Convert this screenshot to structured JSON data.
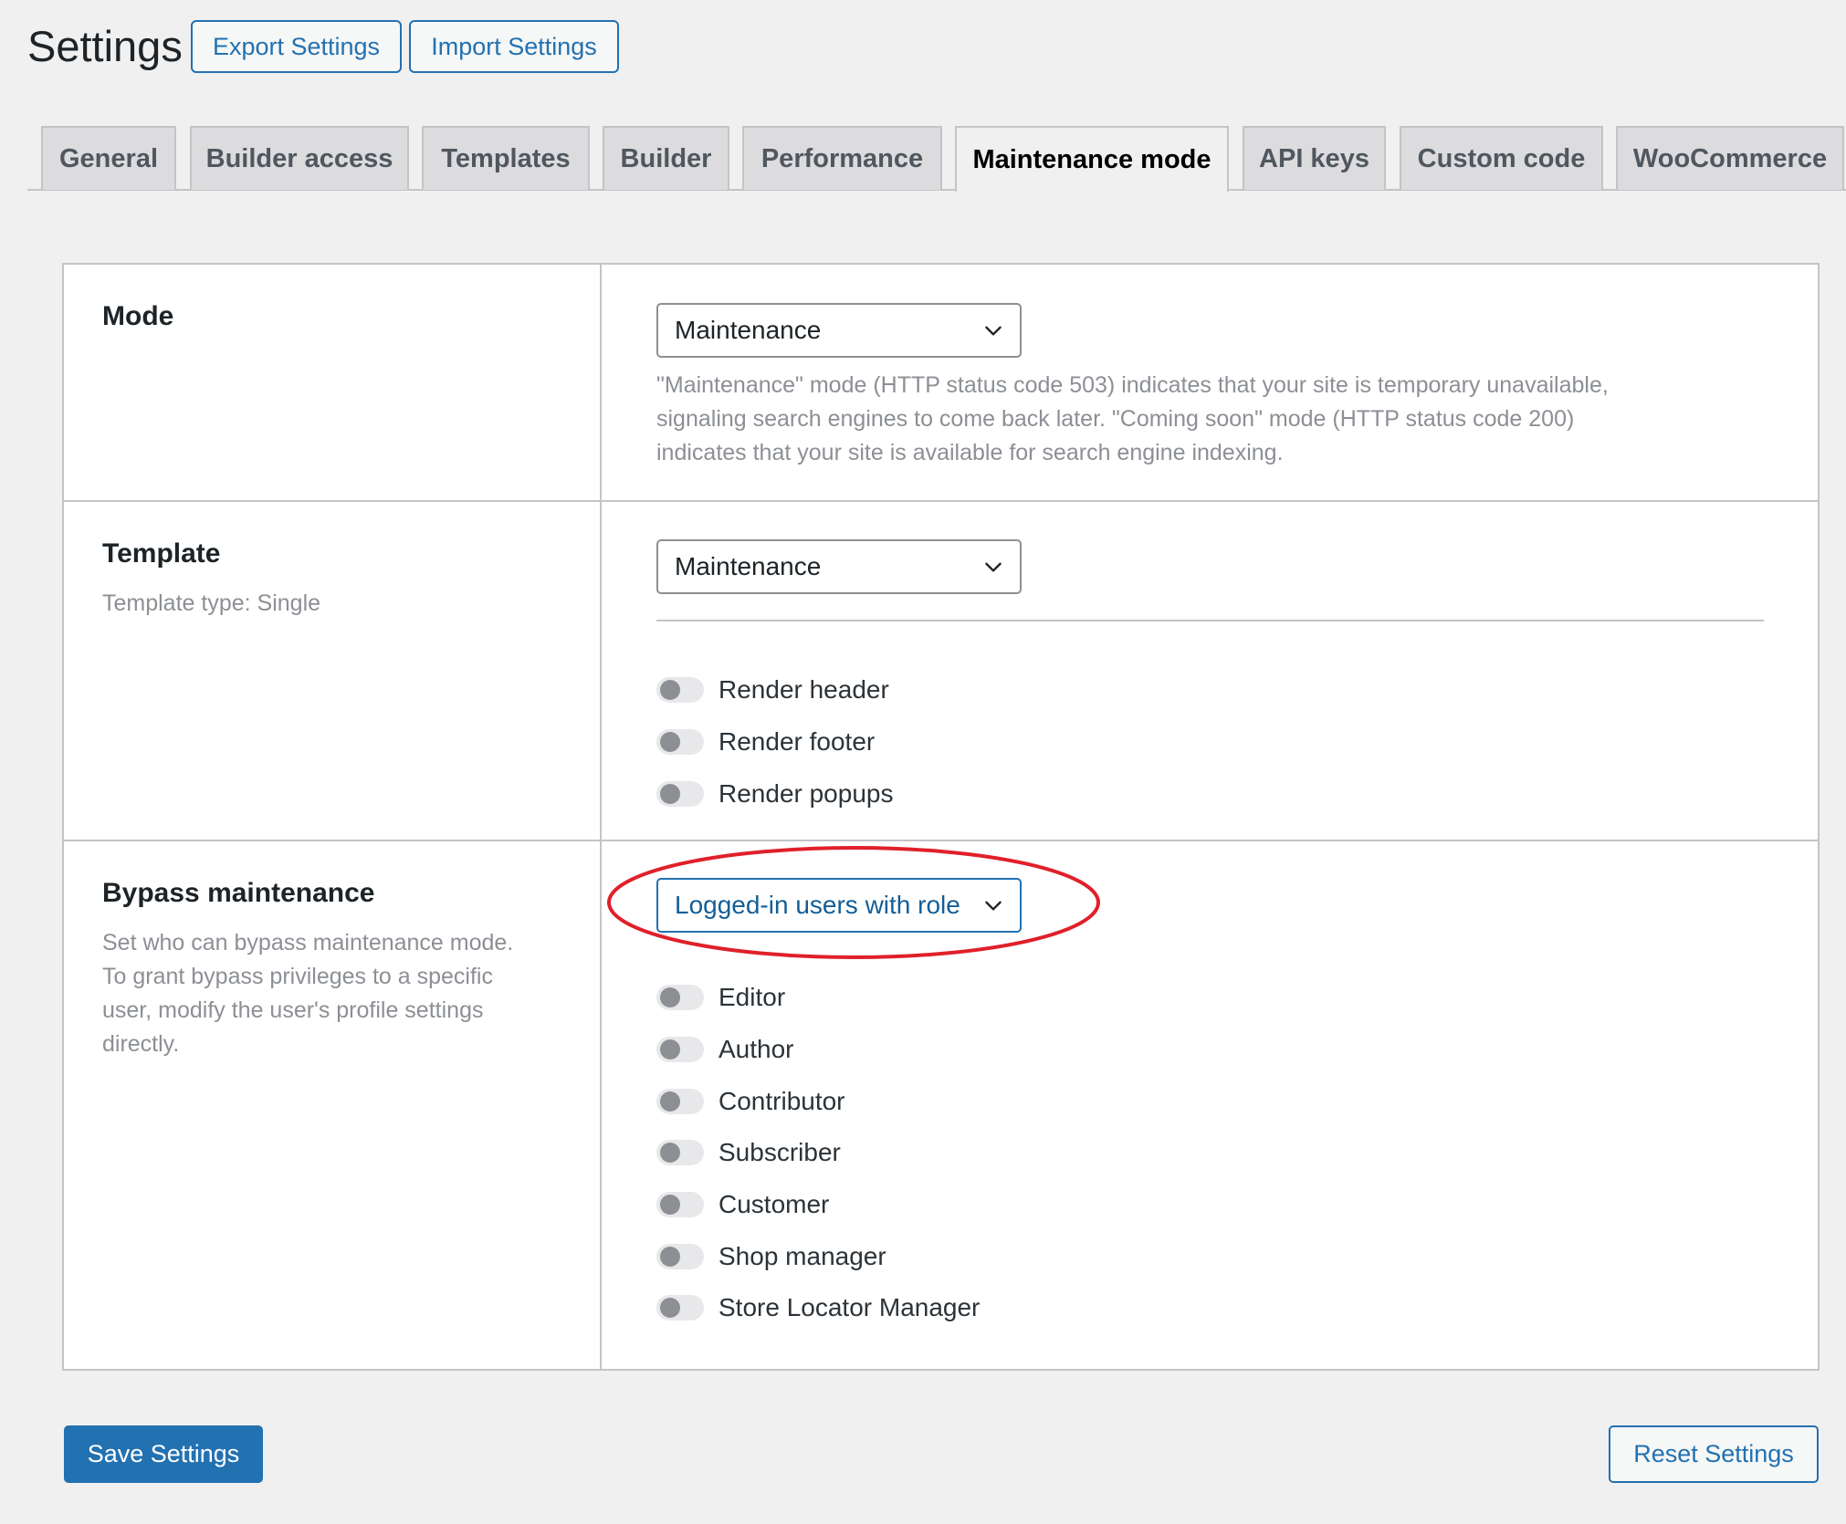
{
  "header": {
    "title": "Settings",
    "export_label": "Export Settings",
    "import_label": "Import Settings"
  },
  "tabs": [
    {
      "label": "General"
    },
    {
      "label": "Builder access"
    },
    {
      "label": "Templates"
    },
    {
      "label": "Builder"
    },
    {
      "label": "Performance"
    },
    {
      "label": "Maintenance mode",
      "active": true
    },
    {
      "label": "API keys"
    },
    {
      "label": "Custom code"
    },
    {
      "label": "WooCommerce"
    }
  ],
  "mode": {
    "title": "Mode",
    "select_value": "Maintenance",
    "help_lines": [
      "\"Maintenance\" mode (HTTP status code 503) indicates that your site is temporary unavailable,",
      "signaling search engines to come back later. \"Coming soon\" mode (HTTP status code 200)",
      "indicates that your site is available for search engine indexing."
    ]
  },
  "template": {
    "title": "Template",
    "desc": "Template type: Single",
    "select_value": "Maintenance",
    "toggles": [
      {
        "label": "Render header",
        "on": false
      },
      {
        "label": "Render footer",
        "on": false
      },
      {
        "label": "Render popups",
        "on": false
      }
    ]
  },
  "bypass": {
    "title": "Bypass maintenance",
    "desc_lines": [
      "Set who can bypass maintenance mode.",
      "To grant bypass privileges to a specific",
      "user, modify the user's profile settings",
      "directly."
    ],
    "select_value": "Logged-in users with role",
    "roles": [
      {
        "label": "Editor",
        "on": false
      },
      {
        "label": "Author",
        "on": false
      },
      {
        "label": "Contributor",
        "on": false
      },
      {
        "label": "Subscriber",
        "on": false
      },
      {
        "label": "Customer",
        "on": false
      },
      {
        "label": "Shop manager",
        "on": false
      },
      {
        "label": "Store Locator Manager",
        "on": false
      }
    ]
  },
  "footer": {
    "save_label": "Save Settings",
    "reset_label": "Reset Settings"
  },
  "colors": {
    "accent": "#2271b1",
    "annotation": "#e0202a"
  }
}
